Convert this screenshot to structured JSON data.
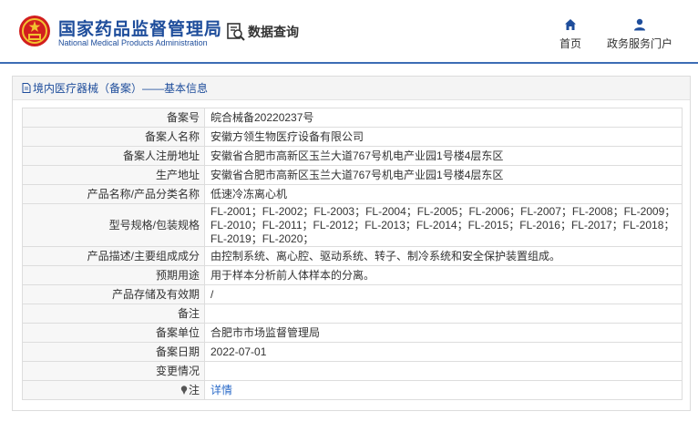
{
  "header": {
    "brand_cn": "国家药品监督管理局",
    "brand_en": "National Medical Products Administration",
    "query_label": "数据查询",
    "nav": {
      "home": "首页",
      "service": "政务服务门户"
    }
  },
  "panel": {
    "title": "境内医疗器械（备案）——基本信息"
  },
  "rows": [
    {
      "label": "备案号",
      "value": "皖合械备20220237号"
    },
    {
      "label": "备案人名称",
      "value": "安徽方领生物医疗设备有限公司"
    },
    {
      "label": "备案人注册地址",
      "value": "安徽省合肥市高新区玉兰大道767号机电产业园1号楼4层东区"
    },
    {
      "label": "生产地址",
      "value": "安徽省合肥市高新区玉兰大道767号机电产业园1号楼4层东区"
    },
    {
      "label": "产品名称/产品分类名称",
      "value": "低速冷冻离心机"
    },
    {
      "label": "型号规格/包装规格",
      "value": "FL-2001；FL-2002；FL-2003；FL-2004；FL-2005；FL-2006；FL-2007；FL-2008；FL-2009；FL-2010；FL-2011；FL-2012；FL-2013；FL-2014；FL-2015；FL-2016；FL-2017；FL-2018；FL-2019；FL-2020；"
    },
    {
      "label": "产品描述/主要组成成分",
      "value": "由控制系统、离心腔、驱动系统、转子、制冷系统和安全保护装置组成。"
    },
    {
      "label": "预期用途",
      "value": "用于样本分析前人体样本的分离。"
    },
    {
      "label": "产品存储及有效期",
      "value": "/"
    },
    {
      "label": "备注",
      "value": ""
    },
    {
      "label": "备案单位",
      "value": "合肥市市场监督管理局"
    },
    {
      "label": "备案日期",
      "value": "2022-07-01"
    },
    {
      "label": "变更情况",
      "value": ""
    },
    {
      "label": "注",
      "value": "详情"
    }
  ],
  "colors": {
    "brand_blue": "#1e4d9b",
    "link_blue": "#2a6ac8",
    "header_rule": "#3d6db5",
    "emblem_red": "#d21f1f"
  },
  "icons": {
    "logo": "national-emblem-icon",
    "query": "search-document-icon",
    "home": "home-icon",
    "service": "user-icon",
    "title": "document-icon",
    "note": "pin-icon"
  }
}
